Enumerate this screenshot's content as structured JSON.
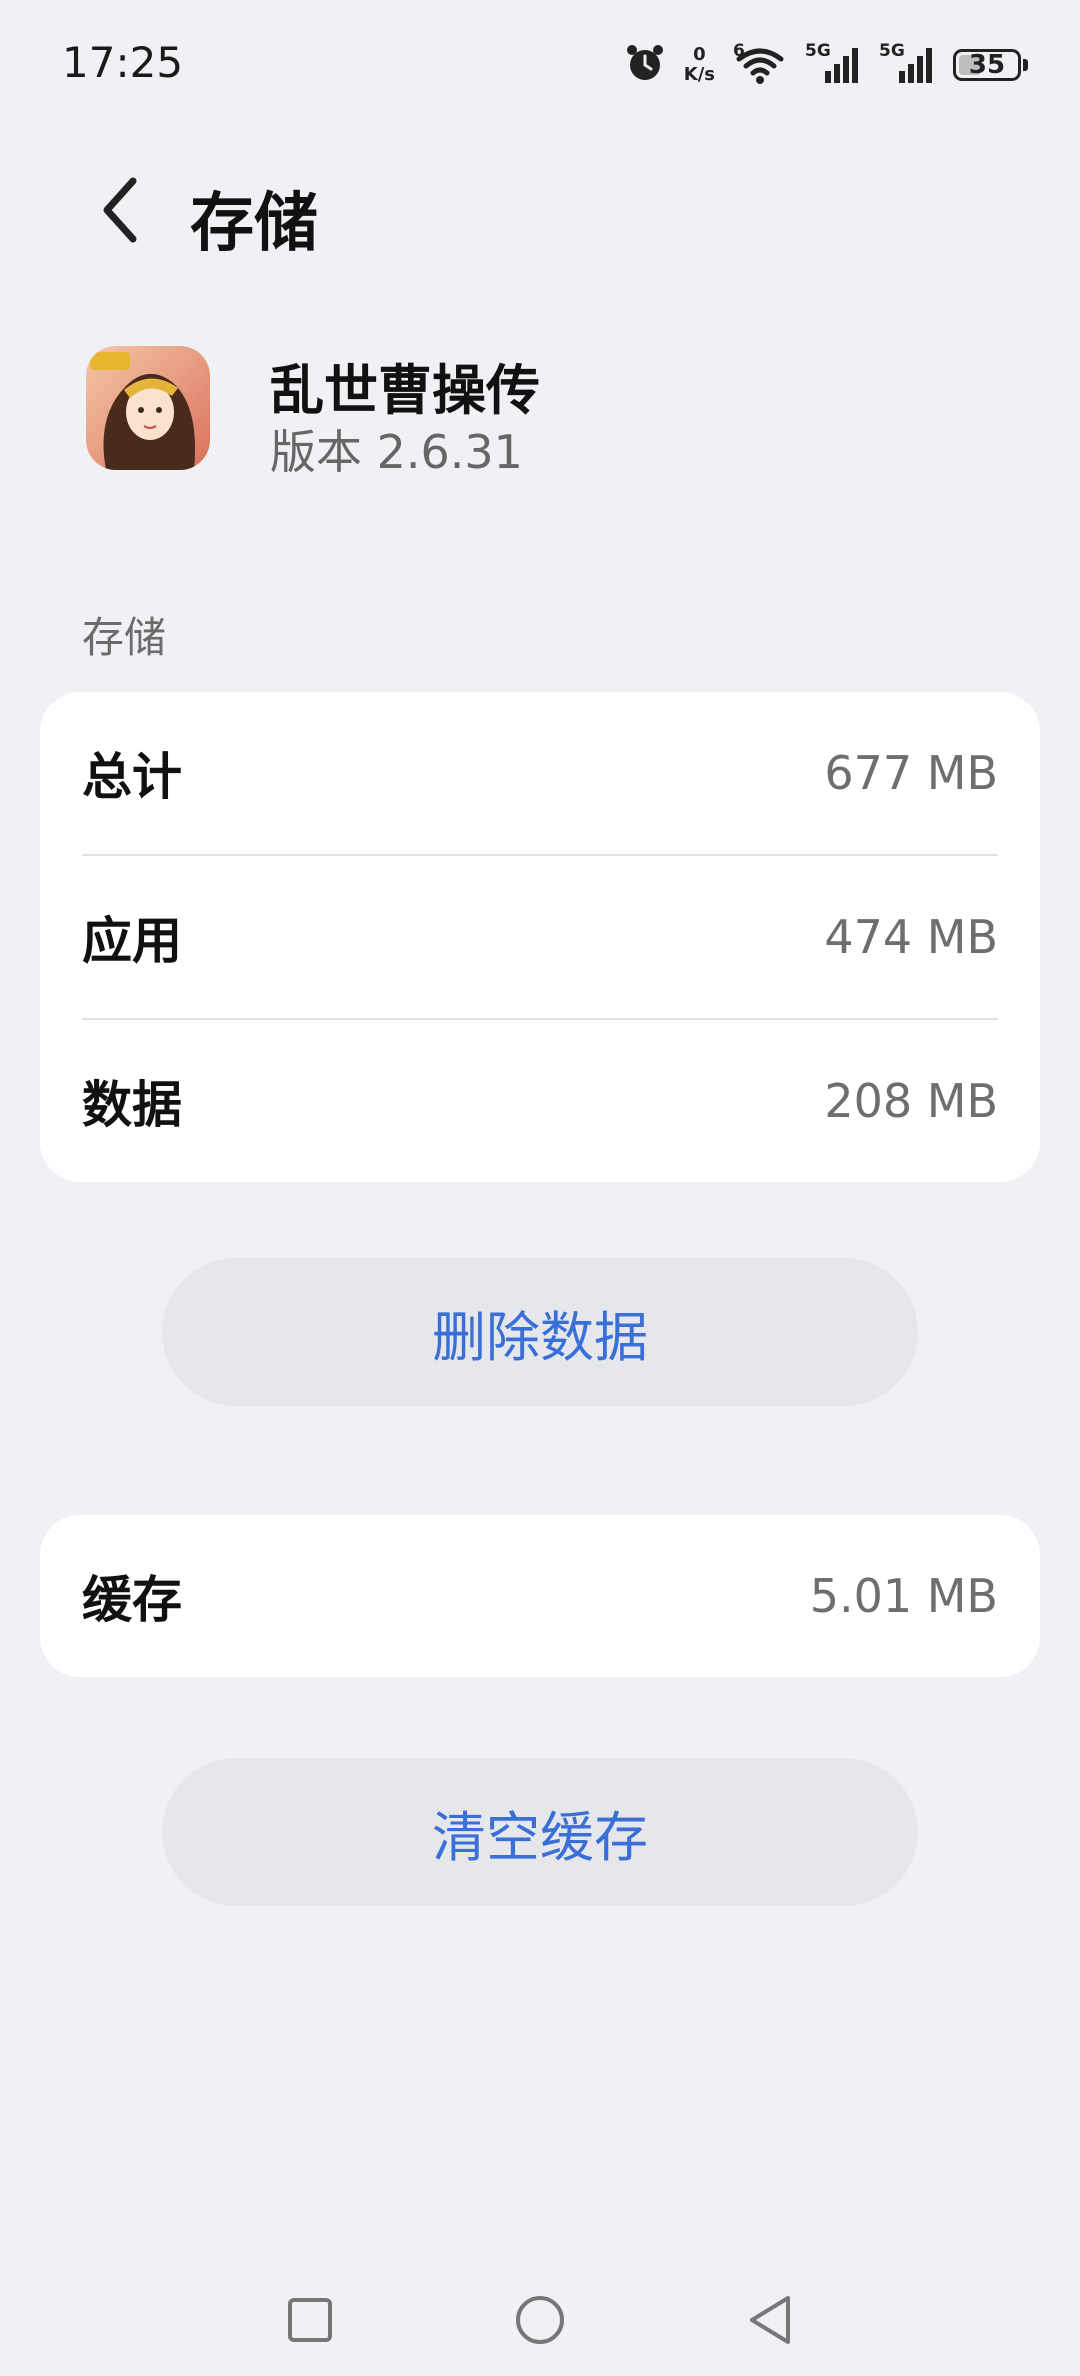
{
  "status_bar": {
    "time": "17:25",
    "net_speed_value": "0",
    "net_speed_unit": "K/s",
    "wifi_badge": "6",
    "sim1_label": "5G",
    "sim2_label": "5G",
    "battery_level": "35",
    "icons": [
      "alarm-icon",
      "wifi-icon",
      "signal-icon",
      "signal-icon",
      "battery-icon"
    ]
  },
  "header": {
    "title": "存储",
    "back_icon": "chevron-left-icon"
  },
  "app": {
    "name": "乱世曹操传",
    "version": "版本 2.6.31"
  },
  "storage_section": {
    "label": "存储",
    "rows": [
      {
        "label": "总计",
        "value": "677 MB"
      },
      {
        "label": "应用",
        "value": "474 MB"
      },
      {
        "label": "数据",
        "value": "208 MB"
      }
    ]
  },
  "delete_data_button": "删除数据",
  "cache": {
    "label": "缓存",
    "value": "5.01 MB"
  },
  "clear_cache_button": "清空缓存",
  "nav": {
    "icons": [
      "recents-square-icon",
      "home-circle-icon",
      "back-triangle-icon"
    ]
  },
  "colors": {
    "background": "#f0f1f5",
    "card": "#ffffff",
    "button_bg": "#e6e7ea",
    "accent_text": "#3a6fd8"
  }
}
